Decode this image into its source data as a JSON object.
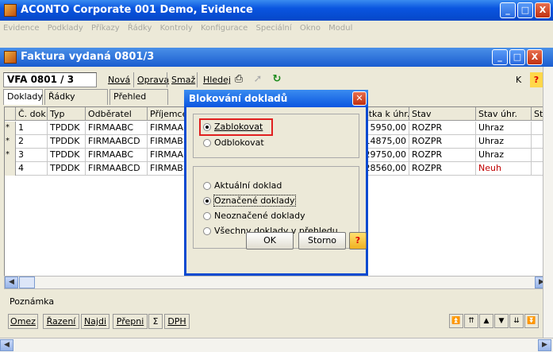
{
  "app": {
    "title": "ACONTO Corporate 001 Demo, Evidence",
    "menu": [
      "Evidence",
      "Podklady",
      "Příkazy",
      "Řádky",
      "Kontroly",
      "Konfigurace",
      "Speciální",
      "Okno",
      "Modul"
    ],
    "window_buttons": {
      "minimize": "_",
      "maximize": "□",
      "close": "X"
    }
  },
  "subwindow": {
    "title": "Faktura vydaná 0801/3",
    "doc_number": "VFA 0801 / 3",
    "toolbar": {
      "new": "Nová",
      "edit": "Oprava",
      "delete": "Smaž",
      "search": "Hledej",
      "k": "K",
      "help": "?"
    },
    "tabs": [
      "Doklady",
      "Řádky dokladu",
      "Přehled řádků"
    ],
    "grid": {
      "columns": [
        "Č. dok.",
        "Typ",
        "Odběratel",
        "Příjemce",
        "stka k úhr.",
        "Stav",
        "Stav úhr.",
        "St"
      ],
      "rows": [
        {
          "marker": "*",
          "no": "1",
          "type": "TPDDK",
          "customer": "FIRMAABC",
          "recipient": "FIRMAA",
          "amount": "5950,00",
          "state": "ROZPR",
          "pay_state": "Uhraz",
          "pay_alert": false
        },
        {
          "marker": "*",
          "no": "2",
          "type": "TPDDK",
          "customer": "FIRMAABCD",
          "recipient": "FIRMAB",
          "amount": "14875,00",
          "state": "ROZPR",
          "pay_state": "Uhraz",
          "pay_alert": false
        },
        {
          "marker": "*",
          "no": "3",
          "type": "TPDDK",
          "customer": "FIRMAABC",
          "recipient": "FIRMAA",
          "amount": "29750,00",
          "state": "ROZPR",
          "pay_state": "Uhraz",
          "pay_alert": false
        },
        {
          "marker": "",
          "no": "4",
          "type": "TPDDK",
          "customer": "FIRMAABCD",
          "recipient": "FIRMAB",
          "amount": "28560,00",
          "state": "ROZPR",
          "pay_state": "Neuh",
          "pay_alert": true
        }
      ]
    },
    "note_label": "Poznámka",
    "bottom_buttons": {
      "omez": "Omez",
      "razeni": "Řazení",
      "najdi": "Najdi",
      "prepni": "Přepni",
      "sum": "Σ",
      "dph": "DPH"
    },
    "nav_buttons": [
      "⏫",
      "⇈",
      "▲",
      "▼",
      "⇊",
      "⏬"
    ]
  },
  "dialog": {
    "title": "Blokování dokladů",
    "action_options": [
      {
        "label": "Zablokovat",
        "selected": true
      },
      {
        "label": "Odblokovat",
        "selected": false
      }
    ],
    "scope_options": [
      {
        "label": "Aktuální doklad",
        "selected": false
      },
      {
        "label": "Označené doklady",
        "selected": true
      },
      {
        "label": "Neoznačené doklady",
        "selected": false
      },
      {
        "label": "Všechny doklady v přehledu",
        "selected": false
      }
    ],
    "ok_label": "OK",
    "cancel_label": "Storno",
    "help_label": "?"
  },
  "colors": {
    "titlebar": "#0a55e0",
    "highlight": "#e02020",
    "alert_text": "#c00000"
  }
}
